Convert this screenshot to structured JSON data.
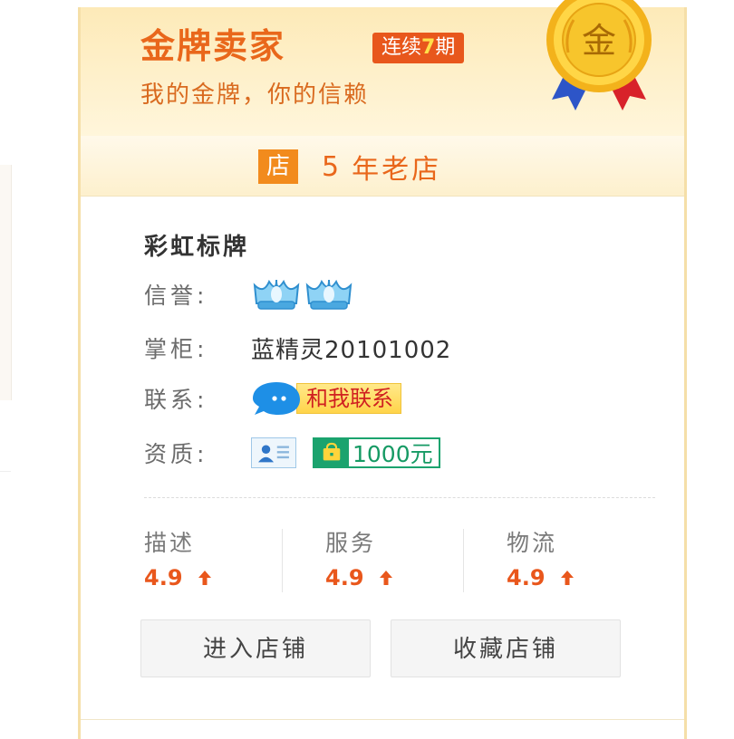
{
  "header": {
    "title": "金牌卖家",
    "streak_prefix": "连续",
    "streak_number": "7",
    "streak_suffix": "期",
    "slogan": "我的金牌，你的信赖",
    "medal_char": "金"
  },
  "shop_age": {
    "badge": "店",
    "years": "5",
    "text": "年老店"
  },
  "shop": {
    "name": "彩虹标牌",
    "reputation_label": "信誉:",
    "reputation_icon": "blue-crown-icon",
    "reputation_count": 2,
    "owner_label": "掌柜:",
    "owner_name": "蓝精灵20101002",
    "contact_label": "联系:",
    "contact_button": "和我联系",
    "qualification_label": "资质:",
    "deposit_amount": "1000元"
  },
  "ratings": [
    {
      "name": "描述",
      "score": "4.9"
    },
    {
      "name": "服务",
      "score": "4.9"
    },
    {
      "name": "物流",
      "score": "4.9"
    }
  ],
  "actions": {
    "enter_shop": "进入店铺",
    "favorite_shop": "收藏店铺"
  },
  "colors": {
    "accent_orange": "#e9671b",
    "streak_bg": "#e8571c",
    "rating_red": "#e9571c",
    "deposit_green": "#1ba36e"
  }
}
